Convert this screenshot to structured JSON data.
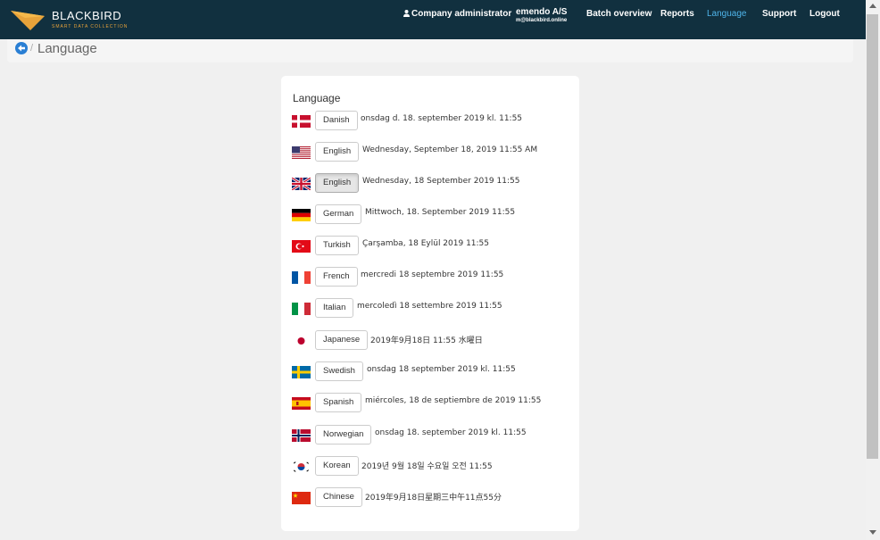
{
  "app": {
    "brand": "BLACKBIRD",
    "brand_sub": "SMART DATA COLLECTION",
    "logo_icon": "blackbird-logo-icon"
  },
  "nav": {
    "company_admin": "Company administrator",
    "org_name": "emendo A/S",
    "org_email": "m@blackbird.online",
    "batch_overview": "Batch overview",
    "reports": "Reports",
    "language": "Language",
    "support": "Support",
    "logout": "Logout",
    "active_item": "Language",
    "active_color": "#4fb4ea",
    "bg_color": "#11303f"
  },
  "breadcrumb": {
    "back_icon": "back-arrow-circle-icon",
    "separator": "/",
    "title": "Language"
  },
  "card": {
    "title": "Language",
    "languages": [
      {
        "flag": "flag-denmark-icon",
        "label": "Danish",
        "date": "onsdag d. 18. september 2019 kl. 11:55",
        "selected": false
      },
      {
        "flag": "flag-usa-icon",
        "label": "English",
        "date": "Wednesday, September 18, 2019 11:55 AM",
        "selected": false
      },
      {
        "flag": "flag-uk-icon",
        "label": "English",
        "date": "Wednesday, 18 September 2019 11:55",
        "selected": true
      },
      {
        "flag": "flag-germany-icon",
        "label": "German",
        "date": "Mittwoch, 18. September 2019 11:55",
        "selected": false
      },
      {
        "flag": "flag-turkey-icon",
        "label": "Turkish",
        "date": "Çarşamba, 18 Eylül 2019 11:55",
        "selected": false
      },
      {
        "flag": "flag-france-icon",
        "label": "French",
        "date": "mercredi 18 septembre 2019 11:55",
        "selected": false
      },
      {
        "flag": "flag-italy-icon",
        "label": "Italian",
        "date": "mercoledì 18 settembre 2019 11:55",
        "selected": false
      },
      {
        "flag": "flag-japan-icon",
        "label": "Japanese",
        "date": "2019年9月18日 11:55 水曜日",
        "selected": false
      },
      {
        "flag": "flag-sweden-icon",
        "label": "Swedish",
        "date": "onsdag 18 september 2019 kl. 11:55",
        "selected": false
      },
      {
        "flag": "flag-spain-icon",
        "label": "Spanish",
        "date": "miércoles, 18 de septiembre de 2019 11:55",
        "selected": false
      },
      {
        "flag": "flag-norway-icon",
        "label": "Norwegian",
        "date": "onsdag 18. september 2019 kl. 11:55",
        "selected": false
      },
      {
        "flag": "flag-korea-icon",
        "label": "Korean",
        "date": "2019년 9월 18일 수요일 오전 11:55",
        "selected": false
      },
      {
        "flag": "flag-china-icon",
        "label": "Chinese",
        "date": "2019年9月18日星期三中午11点55分",
        "selected": false
      }
    ]
  }
}
